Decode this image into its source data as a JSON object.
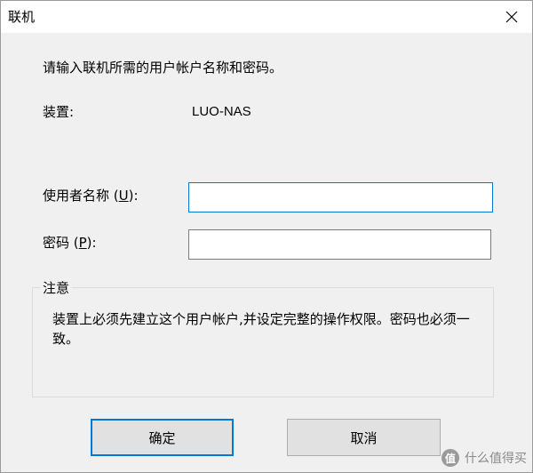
{
  "window": {
    "title": "联机"
  },
  "dialog": {
    "prompt": "请输入联机所需的用户帐户名称和密码。",
    "device_label": "装置:",
    "device_value": "LUO-NAS"
  },
  "fields": {
    "username_label_pre": "使用者名称 (",
    "username_label_key": "U",
    "username_label_post": "):",
    "username_value": "",
    "password_label_pre": "密码 (",
    "password_label_key": "P",
    "password_label_post": "):",
    "password_value": ""
  },
  "notice": {
    "title": "注意",
    "text": "装置上必须先建立这个用户帐户,并设定完整的操作权限。密码也必须一致。"
  },
  "buttons": {
    "ok": "确定",
    "cancel": "取消"
  },
  "watermark": {
    "logo": "值",
    "text": "什么值得买"
  },
  "icons": {
    "close": "close-icon"
  }
}
